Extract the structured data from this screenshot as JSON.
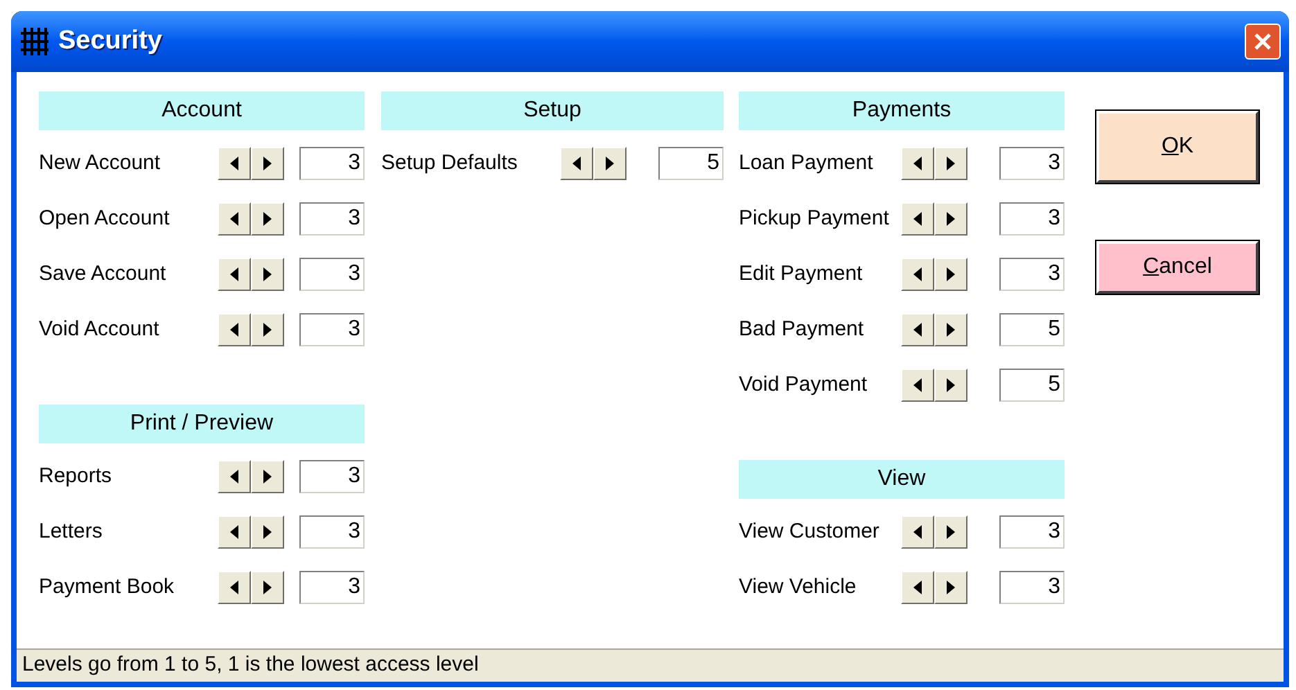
{
  "window": {
    "title": "Security"
  },
  "columns": [
    {
      "sections": [
        {
          "title": "Account",
          "rows": [
            {
              "label": "New Account",
              "value": "3"
            },
            {
              "label": "Open Account",
              "value": "3"
            },
            {
              "label": "Save Account",
              "value": "3"
            },
            {
              "label": "Void Account",
              "value": "3"
            }
          ]
        },
        {
          "title": "Print / Preview",
          "rows": [
            {
              "label": "Reports",
              "value": "3"
            },
            {
              "label": "Letters",
              "value": "3"
            },
            {
              "label": "Payment Book",
              "value": "3"
            }
          ]
        }
      ]
    },
    {
      "sections": [
        {
          "title": "Setup",
          "rows": [
            {
              "label": "Setup Defaults",
              "value": "5"
            }
          ]
        }
      ]
    },
    {
      "sections": [
        {
          "title": "Payments",
          "rows": [
            {
              "label": "Loan Payment",
              "value": "3"
            },
            {
              "label": "Pickup Payment",
              "value": "3"
            },
            {
              "label": "Edit Payment",
              "value": "3"
            },
            {
              "label": "Bad Payment",
              "value": "5"
            },
            {
              "label": "Void Payment",
              "value": "5"
            }
          ]
        },
        {
          "title": "View",
          "rows": [
            {
              "label": "View Customer",
              "value": "3"
            },
            {
              "label": "View Vehicle",
              "value": "3"
            }
          ]
        }
      ]
    }
  ],
  "buttons": [
    {
      "label": "OK",
      "kind": "ok"
    },
    {
      "label": "Cancel",
      "kind": "cancel"
    }
  ],
  "status_bar": "Levels go from 1 to 5, 1 is the lowest access level"
}
